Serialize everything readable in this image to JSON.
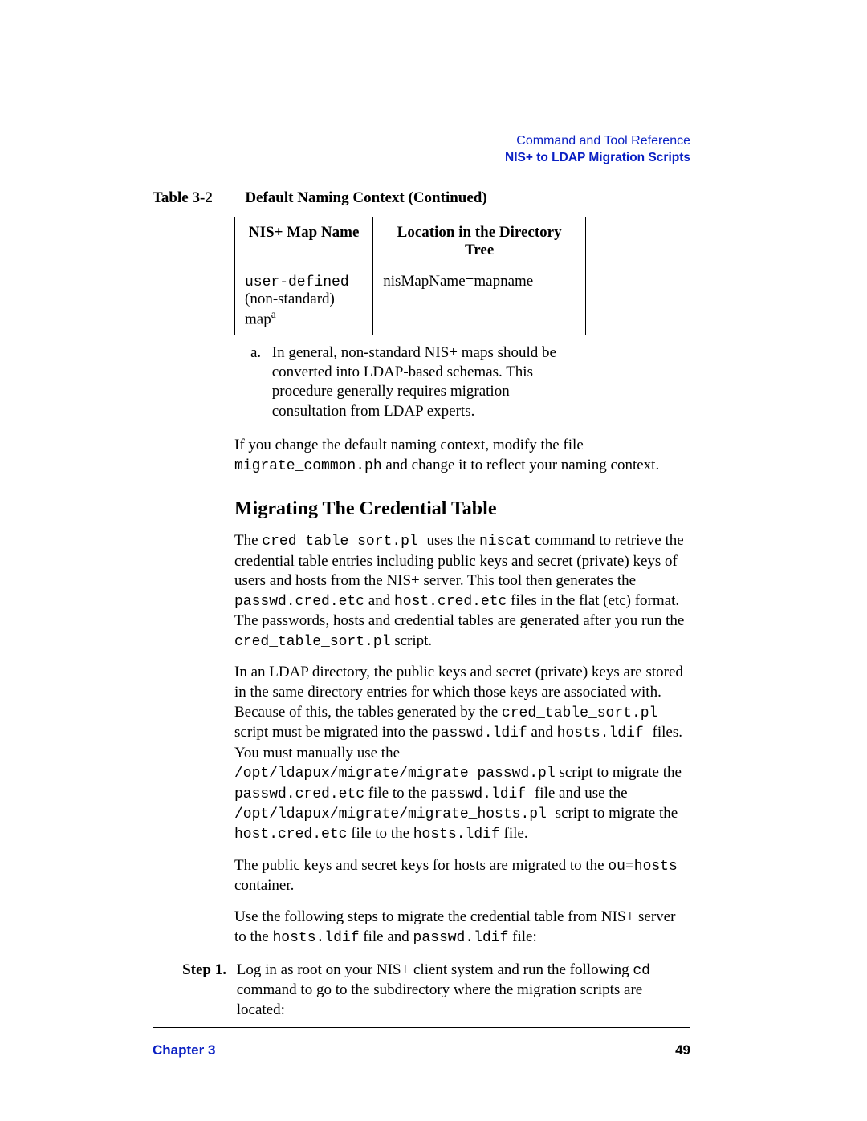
{
  "header": {
    "top": "Command and Tool Reference",
    "sub": "NIS+ to LDAP Migration Scripts"
  },
  "table": {
    "label": "Table 3-2",
    "caption": "Default Naming Context (Continued)",
    "head_col1": "NIS+ Map Name",
    "head_col2": "Location in the Directory Tree",
    "row1_col1_mono": "user-defined",
    "row1_col1_rest": "(non-standard) map",
    "row1_col1_sup": "a",
    "row1_col2": "nisMapName=mapname"
  },
  "footnote": {
    "label": "a.",
    "text": "In general, non-standard NIS+ maps should be converted into LDAP-based schemas. This procedure generally requires migration consultation from LDAP experts."
  },
  "para1_a": "If you change the default naming context, modify the file ",
  "para1_code": "migrate_common.ph",
  "para1_b": " and change it to reflect your naming context.",
  "section_title": "Migrating The Credential Table",
  "p2": {
    "a": "The ",
    "c1": "cred_table_sort.pl ",
    "b": " uses the ",
    "c2": "niscat",
    "c": " command to retrieve the credential table entries including public keys and secret (private) keys of users and hosts from the NIS+ server. This tool then generates the ",
    "c3": "passwd.cred.etc",
    "d": " and ",
    "c4": "host.cred.etc",
    "e": " files in the flat (etc) format. The passwords, hosts and credential tables are generated after you run the ",
    "c5": "cred_table_sort.pl",
    "f": " script."
  },
  "p3": {
    "a": "In an LDAP directory, the public keys and secret (private) keys are stored in the same directory entries for which those keys are associated with. Because of this, the tables generated by the ",
    "c1": "cred_table_sort.pl",
    "b": " script must be migrated into the ",
    "c2": " passwd.ldif",
    "c": " and ",
    "c3": "hosts.ldif ",
    "d": " files. You must manually use the ",
    "c4": "/opt/ldapux/migrate/migrate_passwd.pl",
    "e": " script to migrate the ",
    "c5": "passwd.cred.etc",
    "f": " file to the ",
    "c6": " passwd.ldif ",
    "g": " file and use the ",
    "c7": " /opt/ldapux/migrate/migrate_hosts.pl ",
    "h": " script to migrate the ",
    "c8": "host.cred.etc",
    "i": " file to the ",
    "c9": "hosts.ldif",
    "j": " file."
  },
  "p4": {
    "a": "The public keys and secret keys for hosts are migrated to the ",
    "c1": "ou=hosts",
    "b": " container."
  },
  "p5": {
    "a": "Use the following steps to migrate the credential table from NIS+ server to the ",
    "c1": "hosts.ldif",
    "b": " file and ",
    "c2": "passwd.ldif",
    "c": " file:"
  },
  "step": {
    "label": "Step  1.",
    "a": "Log in as root on your NIS+ client system and run the following ",
    "c1": "cd",
    "b": " command to go to the subdirectory where the migration scripts are located:"
  },
  "footer": {
    "left": "Chapter 3",
    "right": "49"
  }
}
